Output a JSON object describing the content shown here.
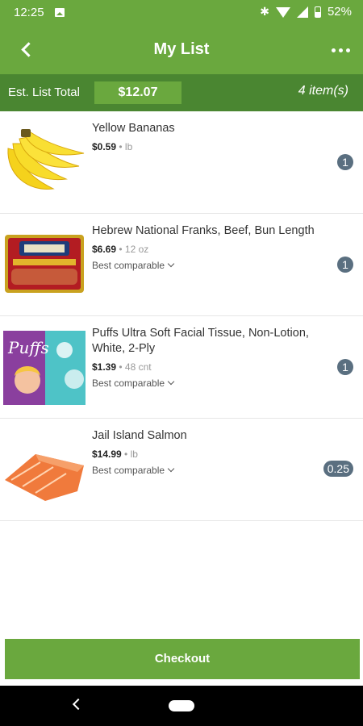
{
  "status": {
    "time": "12:25",
    "battery": "52%"
  },
  "header": {
    "title": "My List"
  },
  "summary": {
    "label": "Est. List Total",
    "total": "$12.07",
    "count": "4 item(s)"
  },
  "items": [
    {
      "name": "Yellow Bananas",
      "price": "$0.59",
      "unit": " • lb",
      "comparable": "",
      "qty": "1"
    },
    {
      "name": "Hebrew National Franks, Beef, Bun Length",
      "price": "$6.69",
      "unit": " • 12 oz",
      "comparable": "Best comparable",
      "qty": "1"
    },
    {
      "name": "Puffs Ultra Soft Facial Tissue, Non-Lotion, White, 2-Ply",
      "price": "$1.39",
      "unit": " • 48 cnt",
      "comparable": "Best comparable",
      "qty": "1"
    },
    {
      "name": "Jail Island Salmon",
      "price": "$14.99",
      "unit": " • lb",
      "comparable": "Best comparable",
      "qty": "0.25"
    }
  ],
  "checkout": {
    "label": "Checkout"
  },
  "colors": {
    "primary": "#6aa83e",
    "dark": "#4a8631",
    "badge": "#5a6f80"
  }
}
